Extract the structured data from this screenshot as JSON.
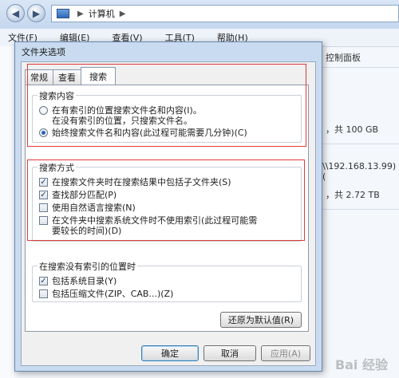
{
  "explorer": {
    "address": "计算机",
    "menu": [
      "文件(F)",
      "编辑(E)",
      "查看(V)",
      "工具(T)",
      "帮助(H)"
    ],
    "right_texts": [
      "控制面板",
      "，共 100 GB",
      "\\\\192.168.13.99) (",
      "，共 2.72 TB"
    ]
  },
  "dialog": {
    "title": "文件夹选项",
    "tabs": [
      "常规",
      "查看",
      "搜索"
    ],
    "search_content": {
      "label": "搜索内容",
      "option1_line1": "在有索引的位置搜索文件名和内容(I)。",
      "option1_line2": "在没有索引的位置，只搜索文件名。",
      "option2": "始终搜索文件名和内容(此过程可能需要几分钟)(C)"
    },
    "search_method": {
      "label": "搜索方式",
      "items": [
        {
          "text": "在搜索文件夹时在搜索结果中包括子文件夹(S)",
          "checked": true
        },
        {
          "text": "查找部分匹配(P)",
          "checked": true
        },
        {
          "text": "使用自然语言搜索(N)",
          "checked": false
        },
        {
          "text_line1": "在文件夹中搜索系统文件时不使用索引(此过程可能需",
          "text_line2": "要较长的时间)(D)",
          "checked": false
        }
      ]
    },
    "no_index": {
      "label": "在搜索没有索引的位置时",
      "items": [
        {
          "text": "包括系统目录(Y)",
          "checked": true
        },
        {
          "text": "包括压缩文件(ZIP、CAB...)(Z)",
          "checked": false
        }
      ]
    },
    "restore_button": "还原为默认值(R)",
    "ok_button": "确定",
    "cancel_button": "取消",
    "apply_button": "应用(A)"
  },
  "check_mark": "✓",
  "watermark": "Bai 经验"
}
